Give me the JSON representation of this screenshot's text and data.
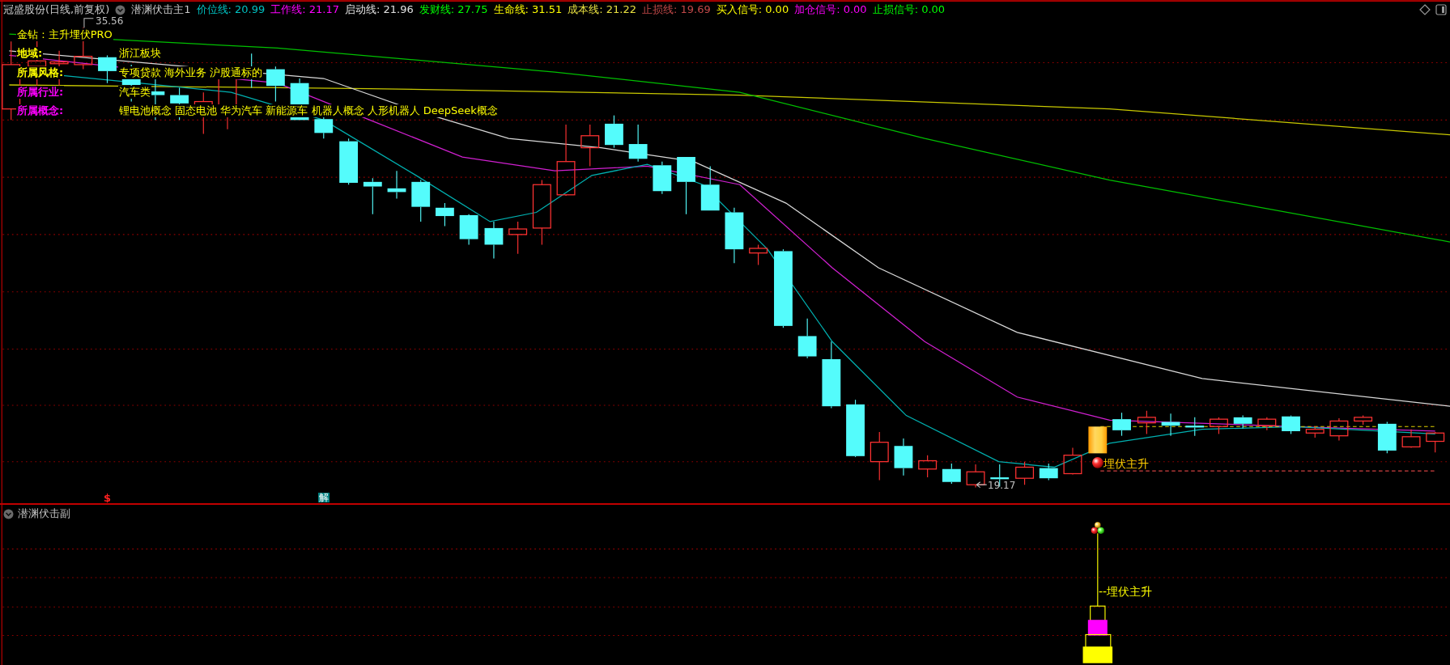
{
  "main_panel": {
    "title": "冠盛股份(日线,前复权)",
    "indicator": "潜渊伏击主1",
    "readouts": [
      {
        "text": "价位线: 20.99",
        "color": "#00c0c0"
      },
      {
        "text": "工作线: 21.17",
        "color": "#ff00ff"
      },
      {
        "text": "启动线: 21.96",
        "color": "#e0e0e0"
      },
      {
        "text": "发财线: 27.75",
        "color": "#00ff00"
      },
      {
        "text": "生命线: 31.51",
        "color": "#ffff00"
      },
      {
        "text": "成本线: 21.22",
        "color": "#e8e040"
      },
      {
        "text": "止损线: 19.69",
        "color": "#c04848"
      },
      {
        "text": "买入信号: 0.00",
        "color": "#fffe00"
      },
      {
        "text": "加仓信号: 0.00",
        "color": "#ff00fe"
      },
      {
        "text": "止损信号: 0.00",
        "color": "#00fe00"
      }
    ],
    "info_title": "金钻 : 主升埋伏PRO",
    "info_rows": [
      {
        "label": "地域:",
        "value": "浙江板块",
        "color": "#ffff00"
      },
      {
        "label": "所属风格:",
        "value": "专项贷款 海外业务 沪股通标的",
        "color": "#ffff01"
      },
      {
        "label": "所属行业:",
        "value": "汽车类",
        "color": "#ff00ff"
      },
      {
        "label": "所属概念:",
        "value": "锂电池概念 固态电池 华为汽车 新能源车 机器人概念 人形机器人 DeepSeek概念",
        "color": "#ff01ff"
      }
    ],
    "high_label": "35.56",
    "low_label": "19.17",
    "signal_label": "埋伏主升",
    "markers": [
      {
        "kind": "dollar",
        "text": "$"
      },
      {
        "kind": "unlock",
        "text": "解"
      }
    ]
  },
  "sub_panel": {
    "title": "潜渊伏击副",
    "signal_label": "--埋伏主升"
  }
}
